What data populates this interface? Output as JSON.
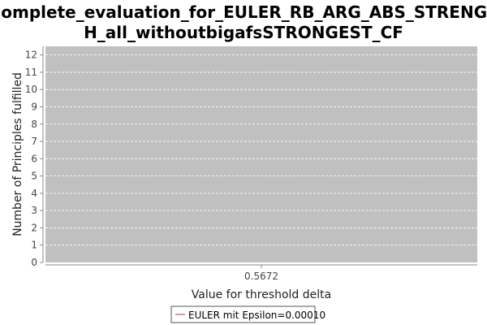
{
  "chart_data": {
    "type": "line",
    "title_lines": [
      "Complete_evaluation_for_EULER_RB_ARG_ABS_STRENGT",
      "H_all_withoutbigafsSTRONGEST_CF"
    ],
    "xlabel": "Value for threshold delta",
    "ylabel": "Number of Principles fulfilled",
    "x_ticks": [
      "0.5672"
    ],
    "y_ticks": [
      0,
      1,
      2,
      3,
      4,
      5,
      6,
      7,
      8,
      9,
      10,
      11,
      12
    ],
    "ylim": [
      0,
      12.5
    ],
    "grid": true,
    "plot_background": "#c0c0c0",
    "series": [
      {
        "name": "EULER mit Epsilon=0.00010",
        "color": "#cc7777",
        "x": [
          "0.5672"
        ],
        "y": [
          null
        ]
      }
    ],
    "legend_position": "bottom-center"
  }
}
